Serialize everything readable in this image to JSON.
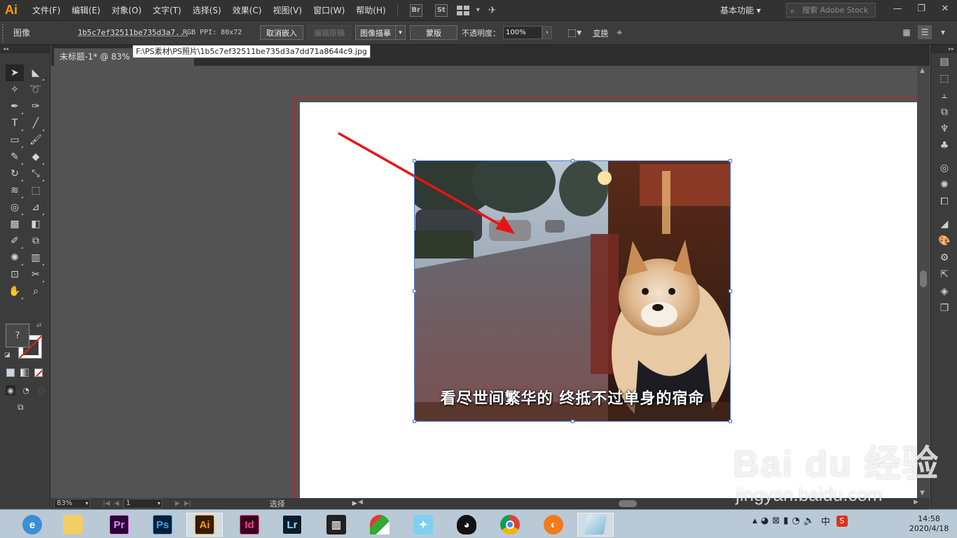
{
  "app": {
    "logo": "Ai",
    "accent": "#ff9a00"
  },
  "menu": {
    "items": [
      "文件(F)",
      "编辑(E)",
      "对象(O)",
      "文字(T)",
      "选择(S)",
      "效果(C)",
      "视图(V)",
      "窗口(W)",
      "帮助(H)"
    ],
    "bridge": "Br",
    "stock": "St",
    "workspace": "基本功能",
    "search_placeholder": "搜索 Adobe Stock"
  },
  "control_bar": {
    "type_label": "图像",
    "file_name": "1b5c7ef32511be735d3a7...",
    "color_info": "RGB  PPI: 80x72",
    "unembed_button": "取消嵌入",
    "edit_original_button": "编辑原稿",
    "image_trace_button": "图像描摹",
    "mask_button": "蒙版",
    "opacity_label": "不透明度：",
    "opacity_value": "100%",
    "transform_label": "变换"
  },
  "document": {
    "tab_title": "未标题-1* @ 83%",
    "tooltip": "F:\\PS素材\\PS照片\\1b5c7ef32511be735d3a7dd71a8644c9.jpg",
    "image_caption": "看尽世间繁华的 终抵不过单身的宿命"
  },
  "status_bar": {
    "zoom": "83%",
    "page": "1",
    "tool": "选择"
  },
  "taskbar": {
    "apps": [
      {
        "name": "ie",
        "label": ""
      },
      {
        "name": "file-explorer",
        "label": ""
      },
      {
        "name": "premiere",
        "label": "Pr",
        "color": "#2a0634",
        "fg": "#e77bff"
      },
      {
        "name": "photoshop",
        "label": "Ps",
        "color": "#061e33",
        "fg": "#31a8ff"
      },
      {
        "name": "illustrator",
        "label": "Ai",
        "color": "#331c00",
        "fg": "#ff9a00"
      },
      {
        "name": "indesign",
        "label": "Id",
        "color": "#33001a",
        "fg": "#ff3d93"
      },
      {
        "name": "lightroom",
        "label": "Lr",
        "color": "#0a1c2a",
        "fg": "#a9d4f5"
      },
      {
        "name": "video-editor",
        "label": ""
      },
      {
        "name": "app-umbrella",
        "label": ""
      },
      {
        "name": "app-bird",
        "label": ""
      },
      {
        "name": "qq",
        "label": ""
      },
      {
        "name": "chrome",
        "label": ""
      },
      {
        "name": "app-orange",
        "label": ""
      },
      {
        "name": "app-glass",
        "label": ""
      }
    ],
    "ime": "中",
    "time": "14:58",
    "date": "2020/4/18"
  },
  "watermark": {
    "brand": "Bai du 经验",
    "url": "jingyan.baidu.com"
  }
}
